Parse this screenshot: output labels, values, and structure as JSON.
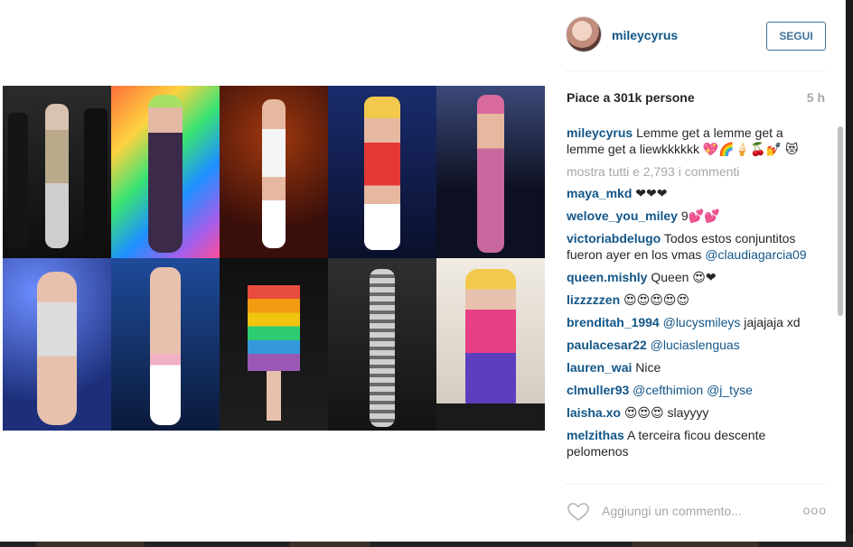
{
  "post": {
    "username": "mileycyrus",
    "follow_label": "SEGUI",
    "likes_text": "Piace a 301k persone",
    "time_ago": "5 h",
    "caption": "Lemme get a lemme get a lemme get a liewkkkkkk 💖🌈🍦🍒💅 😻",
    "show_all_comments": "mostra tutti e 2,793 i commenti",
    "comments": [
      {
        "user": "maya_mkd",
        "text": "❤❤❤",
        "mention": ""
      },
      {
        "user": "welove_you_miley",
        "text": "9💕💕",
        "mention": ""
      },
      {
        "user": "victoriabdelugo",
        "text": "Todos estos conjuntitos fueron ayer en los vmas",
        "mention": "@claudiagarcia09"
      },
      {
        "user": "queen.mishly",
        "text": "Queen 😍❤",
        "mention": ""
      },
      {
        "user": "lizzzzzen",
        "text": "😍😍😍😍😍",
        "mention": ""
      },
      {
        "user": "brenditah_1994",
        "text": "jajajaja xd",
        "mention": "@lucysmileys"
      },
      {
        "user": "paulacesar22",
        "text": "",
        "mention": "@luciaslenguas"
      },
      {
        "user": "lauren_wai",
        "text": "Nice",
        "mention": ""
      },
      {
        "user": "clmuller93",
        "text": "",
        "mention": "@cefthimion @j_tyse"
      },
      {
        "user": "laisha.xo",
        "text": "😍😍😍 slayyyy",
        "mention": ""
      },
      {
        "user": "melzithas",
        "text": "A terceira ficou descente pelomenos",
        "mention": ""
      }
    ],
    "add_comment_placeholder": "Aggiungi un commento...",
    "more_label": "ooo",
    "icons": {
      "like": "heart-outline-icon",
      "options": "more-options-icon"
    }
  },
  "photo_tiles": [
    {
      "bg": "#1b1b1b",
      "accent": "#b7b0a6"
    },
    {
      "bg": "#7a3fcf",
      "accent": "#2a1a3a"
    },
    {
      "bg": "#3a0f0a",
      "accent": "#f2f2f2"
    },
    {
      "bg": "#13245a",
      "accent": "#e53935"
    },
    {
      "bg": "#0d1020",
      "accent": "#c9689f"
    },
    {
      "bg": "#2c3e8a",
      "accent": "#d9d9d9"
    },
    {
      "bg": "#1e4b9a",
      "accent": "#f2f2f2"
    },
    {
      "bg": "#151515",
      "accent": "#e74c3c"
    },
    {
      "bg": "#2a2a2a",
      "accent": "#cfcfcf"
    },
    {
      "bg": "#e9e4dc",
      "accent": "#e63f86"
    }
  ]
}
